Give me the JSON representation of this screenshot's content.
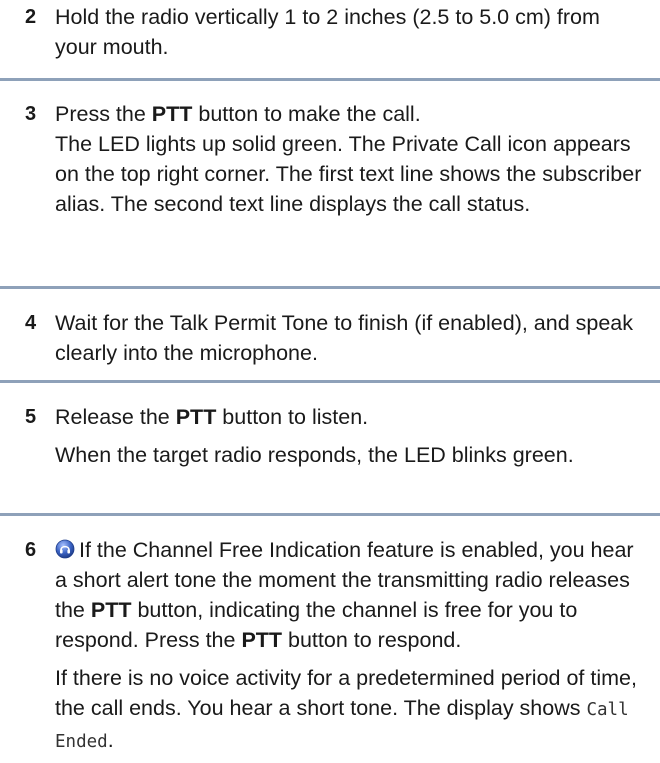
{
  "steps": [
    {
      "number": "2",
      "p1": "Hold the radio vertically 1 to 2 inches (2.5 to 5.0 cm) from your mouth."
    },
    {
      "number": "3",
      "p1_a": "Press the ",
      "p1_b": "PTT",
      "p1_c": " button to make the call.",
      "p2": "The LED lights up solid green. The Private Call icon appears on the top right corner. The first text line shows the subscriber alias. The second text line displays the call status."
    },
    {
      "number": "4",
      "p1": "Wait for the Talk Permit Tone to finish (if enabled), and speak clearly into the microphone."
    },
    {
      "number": "5",
      "p1_a": "Release the ",
      "p1_b": "PTT",
      "p1_c": " button to listen.",
      "p2": "When the target radio responds, the LED blinks green."
    },
    {
      "number": "6",
      "icon": "channel-free-indication-icon",
      "p1_a": "If the Channel Free Indication feature is enabled, you hear a short alert tone the moment the transmitting radio releases the ",
      "p1_b": "PTT",
      "p1_c": " button, indicating the channel is free for you to respond. Press the ",
      "p1_d": "PTT",
      "p1_e": " button to respond.",
      "p2_a": "If there is no voice activity for a predetermined period of time, the call ends. You hear a short tone. The display shows ",
      "p2_b": "Call Ended",
      "p2_c": "."
    }
  ],
  "colors": {
    "separator": "#8ea1b9",
    "icon_blue": "#3b63c4"
  }
}
